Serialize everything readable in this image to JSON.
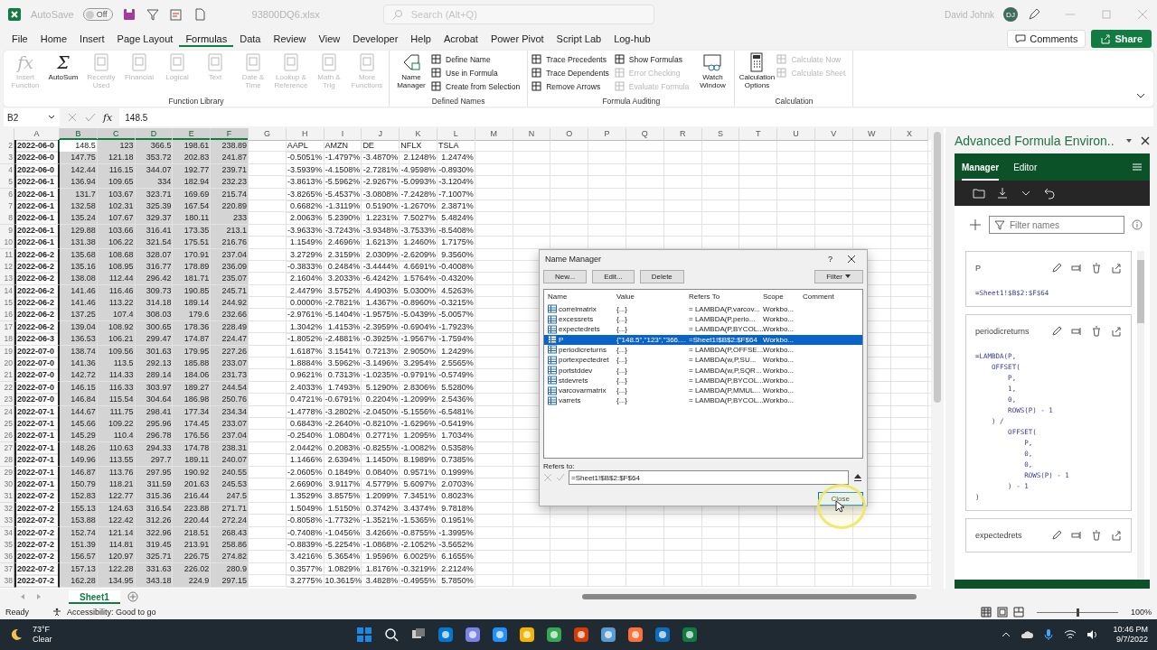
{
  "title_bar": {
    "autosave_label": "AutoSave",
    "autosave_state": "Off",
    "autosave_on": false,
    "file_name": "93800DQ6.xlsx",
    "search_placeholder": "Search (Alt+Q)",
    "user_name": "David Johnk",
    "user_initials": "DJ"
  },
  "menu_tabs": [
    {
      "label": "File",
      "selected": false
    },
    {
      "label": "Home",
      "selected": false
    },
    {
      "label": "Insert",
      "selected": false
    },
    {
      "label": "Page Layout",
      "selected": false
    },
    {
      "label": "Formulas",
      "selected": true
    },
    {
      "label": "Data",
      "selected": false
    },
    {
      "label": "Review",
      "selected": false
    },
    {
      "label": "View",
      "selected": false
    },
    {
      "label": "Developer",
      "selected": false
    },
    {
      "label": "Help",
      "selected": false
    },
    {
      "label": "Acrobat",
      "selected": false
    },
    {
      "label": "Power Pivot",
      "selected": false
    },
    {
      "label": "Script Lab",
      "selected": false
    },
    {
      "label": "Log-hub",
      "selected": false
    }
  ],
  "comments_label": "Comments",
  "share_label": "Share",
  "ribbon": [
    {
      "label": "Function Library",
      "items": [
        {
          "label": "Insert Function",
          "glyph": "fx",
          "kind": "large",
          "disabled": true
        },
        {
          "label": "AutoSum",
          "glyph": "Σ",
          "kind": "large",
          "disabled": false
        },
        {
          "label": "Recently Used",
          "kind": "large",
          "disabled": true
        },
        {
          "label": "Financial",
          "kind": "large",
          "disabled": true
        },
        {
          "label": "Logical",
          "kind": "large",
          "disabled": true
        },
        {
          "label": "Text",
          "kind": "large",
          "disabled": true
        },
        {
          "label": "Date & Time",
          "kind": "large",
          "disabled": true
        },
        {
          "label": "Lookup & Reference",
          "kind": "large",
          "disabled": true
        },
        {
          "label": "Math & Trig",
          "kind": "large",
          "disabled": true
        },
        {
          "label": "More Functions",
          "kind": "large",
          "disabled": true
        }
      ]
    },
    {
      "label": "Defined Names",
      "items": [
        {
          "label": "Name Manager",
          "kind": "large",
          "disabled": false
        },
        {
          "label": "Define Name",
          "kind": "small",
          "disabled": false
        },
        {
          "label": "Use in Formula",
          "kind": "small",
          "disabled": false
        },
        {
          "label": "Create from Selection",
          "kind": "small",
          "disabled": false
        }
      ]
    },
    {
      "label": "Formula Auditing",
      "items": [
        {
          "label": "Trace Precedents",
          "kind": "small",
          "disabled": false
        },
        {
          "label": "Trace Dependents",
          "kind": "small",
          "disabled": false
        },
        {
          "label": "Remove Arrows",
          "kind": "small",
          "disabled": false
        },
        {
          "label": "Show Formulas",
          "kind": "small",
          "disabled": false
        },
        {
          "label": "Error Checking",
          "kind": "small",
          "disabled": true
        },
        {
          "label": "Evaluate Formula",
          "kind": "small",
          "disabled": true
        },
        {
          "label": "Watch Window",
          "kind": "large",
          "disabled": false
        }
      ]
    },
    {
      "label": "Calculation",
      "items": [
        {
          "label": "Calculation Options",
          "kind": "large",
          "disabled": false
        },
        {
          "label": "Calculate Now",
          "kind": "small",
          "disabled": true
        },
        {
          "label": "Calculate Sheet",
          "kind": "small",
          "disabled": true
        }
      ]
    }
  ],
  "formula_bar": {
    "name_box": "B2",
    "glyph": "fx",
    "value": "148.5"
  },
  "sheet": {
    "range_selected": true,
    "columns": [
      {
        "label": "A",
        "selected": false
      },
      {
        "label": "B",
        "selected": true
      },
      {
        "label": "C",
        "selected": true
      },
      {
        "label": "D",
        "selected": true
      },
      {
        "label": "E",
        "selected": true
      },
      {
        "label": "F",
        "selected": true
      },
      {
        "label": "G",
        "selected": false
      },
      {
        "label": "H",
        "selected": false
      },
      {
        "label": "I",
        "selected": false
      },
      {
        "label": "J",
        "selected": false
      },
      {
        "label": "K",
        "selected": false
      },
      {
        "label": "L",
        "selected": false
      },
      {
        "label": "M",
        "selected": false
      },
      {
        "label": "N",
        "selected": false
      },
      {
        "label": "O",
        "selected": false
      },
      {
        "label": "P",
        "selected": false
      },
      {
        "label": "Q",
        "selected": false
      },
      {
        "label": "R",
        "selected": false
      },
      {
        "label": "S",
        "selected": false
      },
      {
        "label": "T",
        "selected": false
      },
      {
        "label": "U",
        "selected": false
      },
      {
        "label": "V",
        "selected": false
      },
      {
        "label": "W",
        "selected": false
      },
      {
        "label": "X",
        "selected": false
      }
    ],
    "rows": [
      {
        "row": "2",
        "kind": "header",
        "date": "2022-06-0",
        "prices": [
          "148.5",
          "123",
          "366.5",
          "198.61",
          "238.89"
        ],
        "h_l": [
          "AAPL",
          "AMZN",
          "DE",
          "NFLX",
          "TSLA"
        ]
      },
      {
        "row": "3",
        "kind": "data",
        "date": "2022-06-0",
        "prices": [
          "147.75",
          "121.18",
          "353.72",
          "202.83",
          "241.87"
        ],
        "h_l": [
          "-0.5051%",
          "-1.4797%",
          "-3.4870%",
          "2.1248%",
          "1.2474%"
        ]
      },
      {
        "row": "4",
        "kind": "data",
        "date": "2022-06-0",
        "prices": [
          "142.44",
          "116.15",
          "344.07",
          "192.77",
          "239.71"
        ],
        "h_l": [
          "-3.5939%",
          "-4.1508%",
          "-2.7281%",
          "-4.9598%",
          "-0.8930%"
        ]
      },
      {
        "row": "5",
        "kind": "data",
        "date": "2022-06-1",
        "prices": [
          "136.94",
          "109.65",
          "334",
          "182.94",
          "232.23"
        ],
        "h_l": [
          "-3.8613%",
          "-5.5962%",
          "-2.9267%",
          "-5.0993%",
          "-3.1204%"
        ]
      },
      {
        "row": "6",
        "kind": "data",
        "date": "2022-06-1",
        "prices": [
          "131.7",
          "103.67",
          "323.71",
          "169.69",
          "215.74"
        ],
        "h_l": [
          "-3.8265%",
          "-5.4537%",
          "-3.0808%",
          "-7.2428%",
          "-7.1007%"
        ]
      },
      {
        "row": "7",
        "kind": "data",
        "date": "2022-06-1",
        "prices": [
          "132.58",
          "102.31",
          "325.39",
          "167.54",
          "220.89"
        ],
        "h_l": [
          "0.6682%",
          "-1.3119%",
          "0.5190%",
          "-1.2670%",
          "2.3871%"
        ]
      },
      {
        "row": "8",
        "kind": "data",
        "date": "2022-06-1",
        "prices": [
          "135.24",
          "107.67",
          "329.37",
          "180.11",
          "233"
        ],
        "h_l": [
          "2.0063%",
          "5.2390%",
          "1.2231%",
          "7.5027%",
          "5.4824%"
        ]
      },
      {
        "row": "9",
        "kind": "data",
        "date": "2022-06-1",
        "prices": [
          "129.88",
          "103.66",
          "316.41",
          "173.35",
          "213.1"
        ],
        "h_l": [
          "-3.9633%",
          "-3.7243%",
          "-3.9348%",
          "-3.7533%",
          "-8.5408%"
        ]
      },
      {
        "row": "10",
        "kind": "data",
        "date": "2022-06-1",
        "prices": [
          "131.38",
          "106.22",
          "321.54",
          "175.51",
          "216.76"
        ],
        "h_l": [
          "1.1549%",
          "2.4696%",
          "1.6213%",
          "1.2460%",
          "1.7175%"
        ]
      },
      {
        "row": "11",
        "kind": "data",
        "date": "2022-06-2",
        "prices": [
          "135.68",
          "108.68",
          "328.07",
          "170.91",
          "237.04"
        ],
        "h_l": [
          "3.2729%",
          "2.3159%",
          "2.0309%",
          "-2.6209%",
          "9.3560%"
        ]
      },
      {
        "row": "12",
        "kind": "data",
        "date": "2022-06-2",
        "prices": [
          "135.16",
          "108.95",
          "316.77",
          "178.89",
          "236.09"
        ],
        "h_l": [
          "-0.3833%",
          "0.2484%",
          "-3.4444%",
          "4.6691%",
          "-0.4008%"
        ]
      },
      {
        "row": "13",
        "kind": "data",
        "date": "2022-06-2",
        "prices": [
          "138.08",
          "112.44",
          "296.42",
          "181.71",
          "235.07"
        ],
        "h_l": [
          "2.1604%",
          "3.2033%",
          "-6.4242%",
          "1.5764%",
          "-0.4320%"
        ]
      },
      {
        "row": "14",
        "kind": "data",
        "date": "2022-06-2",
        "prices": [
          "141.46",
          "116.46",
          "309.73",
          "190.85",
          "245.71"
        ],
        "h_l": [
          "2.4479%",
          "3.5752%",
          "4.4903%",
          "5.0300%",
          "4.5263%"
        ]
      },
      {
        "row": "15",
        "kind": "data",
        "date": "2022-06-2",
        "prices": [
          "141.46",
          "113.22",
          "314.18",
          "189.14",
          "244.92"
        ],
        "h_l": [
          "0.0000%",
          "-2.7821%",
          "1.4367%",
          "-0.8960%",
          "-0.3215%"
        ]
      },
      {
        "row": "16",
        "kind": "data",
        "date": "2022-06-2",
        "prices": [
          "137.25",
          "107.4",
          "308.03",
          "179.6",
          "232.66"
        ],
        "h_l": [
          "-2.9761%",
          "-5.1404%",
          "-1.9575%",
          "-5.0439%",
          "-5.0057%"
        ]
      },
      {
        "row": "17",
        "kind": "data",
        "date": "2022-06-2",
        "prices": [
          "139.04",
          "108.92",
          "300.65",
          "178.36",
          "228.49"
        ],
        "h_l": [
          "1.3042%",
          "1.4153%",
          "-2.3959%",
          "-0.6904%",
          "-1.7923%"
        ]
      },
      {
        "row": "18",
        "kind": "data",
        "date": "2022-06-3",
        "prices": [
          "136.53",
          "106.21",
          "299.47",
          "174.87",
          "224.47"
        ],
        "h_l": [
          "-1.8052%",
          "-2.4881%",
          "-0.3925%",
          "-1.9567%",
          "-1.7594%"
        ]
      },
      {
        "row": "19",
        "kind": "data",
        "date": "2022-07-0",
        "prices": [
          "138.74",
          "109.56",
          "301.63",
          "179.95",
          "227.26"
        ],
        "h_l": [
          "1.6187%",
          "3.1541%",
          "0.7213%",
          "2.9050%",
          "1.2429%"
        ]
      },
      {
        "row": "20",
        "kind": "data",
        "date": "2022-07-0",
        "prices": [
          "141.36",
          "113.5",
          "292.13",
          "185.88",
          "233.07"
        ],
        "h_l": [
          "1.8884%",
          "3.5962%",
          "-3.1496%",
          "3.2954%",
          "2.5565%"
        ]
      },
      {
        "row": "21",
        "kind": "data",
        "date": "2022-07-0",
        "prices": [
          "142.72",
          "114.33",
          "289.14",
          "184.06",
          "231.73"
        ],
        "h_l": [
          "0.9621%",
          "0.7313%",
          "-1.0235%",
          "-0.9791%",
          "-0.5749%"
        ]
      },
      {
        "row": "22",
        "kind": "data",
        "date": "2022-07-0",
        "prices": [
          "146.15",
          "116.33",
          "303.97",
          "189.27",
          "244.54"
        ],
        "h_l": [
          "2.4033%",
          "1.7493%",
          "5.1290%",
          "2.8306%",
          "5.5280%"
        ]
      },
      {
        "row": "23",
        "kind": "data",
        "date": "2022-07-0",
        "prices": [
          "146.84",
          "115.54",
          "304.64",
          "186.98",
          "250.76"
        ],
        "h_l": [
          "0.4721%",
          "-0.6791%",
          "0.2204%",
          "-1.2099%",
          "2.5436%"
        ]
      },
      {
        "row": "24",
        "kind": "data",
        "date": "2022-07-1",
        "prices": [
          "144.67",
          "111.75",
          "298.41",
          "177.34",
          "234.34"
        ],
        "h_l": [
          "-1.4778%",
          "-3.2802%",
          "-2.0450%",
          "-5.1556%",
          "-6.5481%"
        ]
      },
      {
        "row": "25",
        "kind": "data",
        "date": "2022-07-1",
        "prices": [
          "145.66",
          "109.22",
          "295.96",
          "174.45",
          "233.07"
        ],
        "h_l": [
          "0.6843%",
          "-2.2640%",
          "-0.8210%",
          "-1.6296%",
          "-0.5419%"
        ]
      },
      {
        "row": "26",
        "kind": "data",
        "date": "2022-07-1",
        "prices": [
          "145.29",
          "110.4",
          "296.78",
          "176.56",
          "237.04"
        ],
        "h_l": [
          "-0.2540%",
          "1.0804%",
          "0.2771%",
          "1.2095%",
          "1.7034%"
        ]
      },
      {
        "row": "27",
        "kind": "data",
        "date": "2022-07-1",
        "prices": [
          "148.26",
          "110.63",
          "294.33",
          "174.78",
          "238.31"
        ],
        "h_l": [
          "2.0442%",
          "0.2083%",
          "-0.8255%",
          "-1.0082%",
          "0.5358%"
        ]
      },
      {
        "row": "28",
        "kind": "data",
        "date": "2022-07-1",
        "prices": [
          "149.96",
          "113.55",
          "297.7",
          "189.11",
          "240.07"
        ],
        "h_l": [
          "1.1466%",
          "2.6394%",
          "1.1450%",
          "8.1989%",
          "0.7385%"
        ]
      },
      {
        "row": "29",
        "kind": "data",
        "date": "2022-07-1",
        "prices": [
          "146.87",
          "113.76",
          "297.95",
          "190.92",
          "240.55"
        ],
        "h_l": [
          "-2.0605%",
          "0.1849%",
          "0.0840%",
          "0.9571%",
          "0.1999%"
        ]
      },
      {
        "row": "30",
        "kind": "data",
        "date": "2022-07-1",
        "prices": [
          "150.79",
          "118.21",
          "311.59",
          "201.63",
          "245.53"
        ],
        "h_l": [
          "2.6690%",
          "3.9117%",
          "4.5779%",
          "5.6097%",
          "2.0703%"
        ]
      },
      {
        "row": "31",
        "kind": "data",
        "date": "2022-07-2",
        "prices": [
          "152.83",
          "122.77",
          "315.36",
          "216.44",
          "247.5"
        ],
        "h_l": [
          "1.3529%",
          "3.8575%",
          "1.2099%",
          "7.3451%",
          "0.8023%"
        ]
      },
      {
        "row": "32",
        "kind": "data",
        "date": "2022-07-2",
        "prices": [
          "155.13",
          "124.63",
          "316.54",
          "223.88",
          "271.71"
        ],
        "h_l": [
          "1.5049%",
          "1.5150%",
          "0.3742%",
          "3.4374%",
          "9.7818%"
        ]
      },
      {
        "row": "33",
        "kind": "data",
        "date": "2022-07-2",
        "prices": [
          "153.88",
          "122.42",
          "312.26",
          "220.44",
          "272.24"
        ],
        "h_l": [
          "-0.8058%",
          "-1.7732%",
          "-1.3521%",
          "-1.5365%",
          "0.1951%"
        ]
      },
      {
        "row": "34",
        "kind": "data",
        "date": "2022-07-2",
        "prices": [
          "152.74",
          "121.14",
          "322.96",
          "218.51",
          "268.43"
        ],
        "h_l": [
          "-0.7408%",
          "-1.0456%",
          "3.4266%",
          "-0.8755%",
          "-1.3995%"
        ]
      },
      {
        "row": "35",
        "kind": "data",
        "date": "2022-07-2",
        "prices": [
          "151.39",
          "114.81",
          "319.45",
          "213.91",
          "258.86"
        ],
        "h_l": [
          "-0.8839%",
          "-5.2254%",
          "-1.0868%",
          "-2.1052%",
          "-3.5652%"
        ]
      },
      {
        "row": "36",
        "kind": "data",
        "date": "2022-07-2",
        "prices": [
          "156.57",
          "120.97",
          "325.71",
          "226.75",
          "274.82"
        ],
        "h_l": [
          "3.4216%",
          "5.3654%",
          "1.9596%",
          "6.0025%",
          "6.1655%"
        ]
      },
      {
        "row": "37",
        "kind": "data",
        "date": "2022-07-2",
        "prices": [
          "157.13",
          "122.28",
          "331.63",
          "226.02",
          "280.9"
        ],
        "h_l": [
          "0.3577%",
          "1.0829%",
          "1.8176%",
          "-0.3219%",
          "2.2124%"
        ]
      },
      {
        "row": "38",
        "kind": "data",
        "date": "2022-07-2",
        "prices": [
          "162.28",
          "134.95",
          "343.18",
          "224.9",
          "297.15"
        ],
        "h_l": [
          "3.2775%",
          "10.3615%",
          "3.4828%",
          "-0.4955%",
          "5.7850%"
        ]
      }
    ]
  },
  "sheet_tabs": [
    {
      "label": "Sheet1",
      "selected": true
    }
  ],
  "status_bar": {
    "ready": "Ready",
    "accessibility": "Accessibility: Good to go",
    "zoom": "100%",
    "zoom_level": {
      "level": 0.5
    }
  },
  "name_manager": {
    "title": "Name Manager",
    "help": "?",
    "buttons": [
      "New...",
      "Edit...",
      "Delete"
    ],
    "filter_label": "Filter",
    "columns": [
      "Name",
      "Value",
      "Refers To",
      "Scope",
      "Comment"
    ],
    "rows": [
      {
        "name": "correlmatrix",
        "value": "{...}",
        "refers_to": "= LAMBDA(P,varcov...",
        "scope": "Workbo...",
        "selected": false
      },
      {
        "name": "excessrets",
        "value": "{...}",
        "refers_to": "= LAMBDA(P,perio...",
        "scope": "Workbo...",
        "selected": false
      },
      {
        "name": "expectedrets",
        "value": "{...}",
        "refers_to": "= LAMBDA(P,BYCOL...",
        "scope": "Workbo...",
        "selected": false
      },
      {
        "name": "P",
        "value": "{\"148.5\",\"123\",\"366....",
        "refers_to": "=Sheet1!$B$2:$F$64",
        "scope": "Workbo...",
        "selected": true
      },
      {
        "name": "periodicreturns",
        "value": "{...}",
        "refers_to": "= LAMBDA(P,OFFSE...",
        "scope": "Workbo...",
        "selected": false
      },
      {
        "name": "portexpectedret",
        "value": "{...}",
        "refers_to": "= LAMBDA(w,P,SU...",
        "scope": "Workbo...",
        "selected": false
      },
      {
        "name": "portstddev",
        "value": "{...}",
        "refers_to": "= LAMBDA(w,P,SQR...",
        "scope": "Workbo...",
        "selected": false
      },
      {
        "name": "stdevrets",
        "value": "{...}",
        "refers_to": "= LAMBDA(P,BYCOL...",
        "scope": "Workbo...",
        "selected": false
      },
      {
        "name": "varcovarmatrix",
        "value": "{...}",
        "refers_to": "= LAMBDA(P,MMUL...",
        "scope": "Workbo...",
        "selected": false
      },
      {
        "name": "varrets",
        "value": "{...}",
        "refers_to": "= LAMBDA(P,BYCOL...",
        "scope": "Workbo...",
        "selected": false
      }
    ],
    "refers_to_label": "Refers to:",
    "refers_to_value": "=Sheet1!$B$2:$F$64",
    "close_label": "Close"
  },
  "side_panel": {
    "title": "Advanced Formula Environ..",
    "tabs": [
      {
        "label": "Manager",
        "selected": true
      },
      {
        "label": "Editor",
        "selected": false
      }
    ],
    "filter_placeholder": "Filter names",
    "cards": [
      {
        "name": "P",
        "lines": [
          "=Sheet1!$B$2:$F$64"
        ]
      },
      {
        "name": "periodicreturns",
        "lines": [
          "=LAMBDA(P,",
          "    OFFSET(",
          "        P,",
          "        1,",
          "        0,",
          "        ROWS(P) - 1",
          "    ) /",
          "        OFFSET(",
          "            P,",
          "            0,",
          "            0,",
          "            ROWS(P) - 1",
          "        ) - 1",
          ")"
        ]
      },
      {
        "name": "expectedrets"
      }
    ]
  },
  "taskbar": {
    "temperature": "73°F",
    "weather": "Clear",
    "time": "10:46 PM",
    "date": "9/7/2022"
  }
}
